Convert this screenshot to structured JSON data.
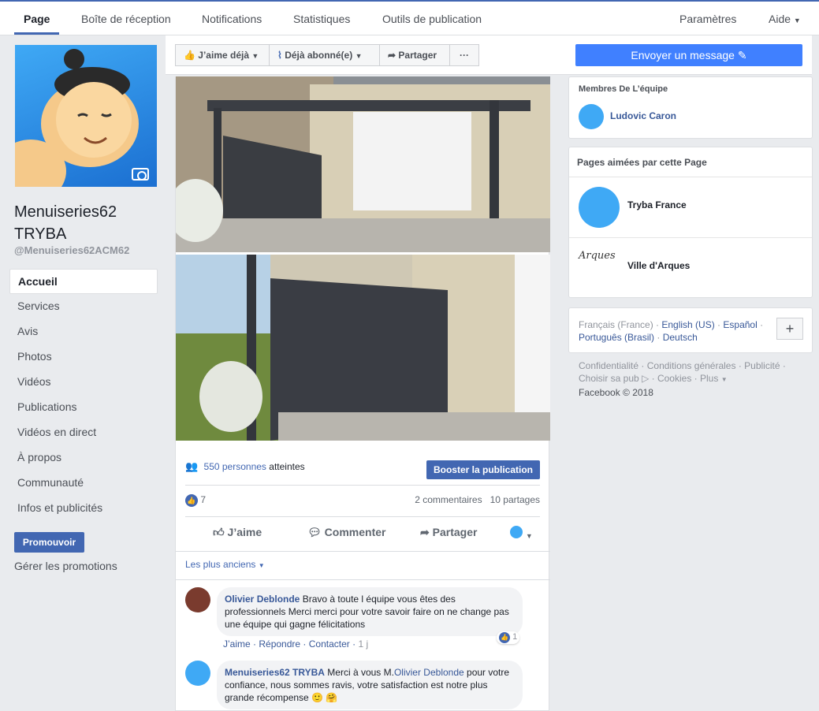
{
  "topnav": {
    "tabs": [
      "Page",
      "Boîte de réception",
      "Notifications",
      "Statistiques",
      "Outils de publication"
    ],
    "settings": "Paramètres",
    "help": "Aide"
  },
  "page": {
    "name": "Menuiseries62 TRYBA",
    "handle": "@Menuiseries62ACM62"
  },
  "leftnav": {
    "items": [
      "Accueil",
      "Services",
      "Avis",
      "Photos",
      "Vidéos",
      "Publications",
      "Vidéos en direct",
      "À propos",
      "Communauté",
      "Infos et publicités"
    ],
    "promote": "Promouvoir",
    "manage_promotions": "Gérer les promotions"
  },
  "actionbar": {
    "like": "J’aime déjà",
    "follow": "Déjà abonné(e)",
    "share": "Partager",
    "more": "···",
    "send_message": "Envoyer un message"
  },
  "post": {
    "reach_count": "550 personnes",
    "reach_suffix": "atteintes",
    "boost": "Booster la publication",
    "likes": "7",
    "comments_count": "2 commentaires",
    "shares_count": "10 partages",
    "actions": {
      "like": "J’aime",
      "comment": "Commenter",
      "share": "Partager"
    },
    "sort": "Les plus anciens",
    "comments": [
      {
        "author": "Olivier Deblonde",
        "text": "Bravo à toute l équipe vous êtes des professionnels Merci merci pour votre savoir faire on ne change pas une équipe qui gagne félicitations",
        "reactions": "1",
        "like": "J’aime",
        "reply": "Répondre",
        "contact": "Contacter",
        "time": "1 j"
      },
      {
        "author": "Menuiseries62 TRYBA",
        "text_before": "Merci à vous M.",
        "mention": "Olivier Deblonde",
        "text_after": " pour votre confiance, nous sommes ravis, votre satisfaction est notre plus grande récompense 🙂 🤗"
      }
    ]
  },
  "right": {
    "team_title": "Membres De L’équipe",
    "team_member": "Ludovic Caron",
    "liked_title": "Pages aimées par cette Page",
    "liked_pages": [
      "Tryba France",
      "Ville d'Arques"
    ],
    "languages": {
      "current": "Français (France)",
      "others": [
        "English (US)",
        "Español",
        "Português (Brasil)",
        "Deutsch"
      ],
      "add": "+"
    },
    "footer": {
      "links": [
        "Confidentialité",
        "Conditions générales",
        "Publicité",
        "Choisir sa pub",
        "Cookies",
        "Plus"
      ],
      "copyright": "Facebook © 2018"
    }
  }
}
